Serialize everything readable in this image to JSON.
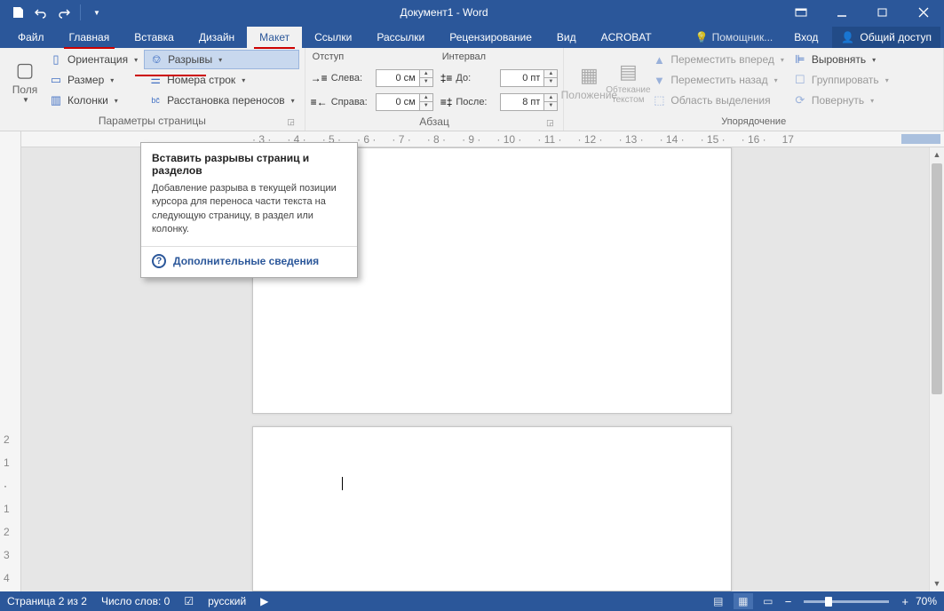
{
  "title": "Документ1 - Word",
  "tabs": {
    "file": "Файл",
    "home": "Главная",
    "insert": "Вставка",
    "design": "Дизайн",
    "layout": "Макет",
    "references": "Ссылки",
    "mailings": "Рассылки",
    "review": "Рецензирование",
    "view": "Вид",
    "acrobat": "ACROBAT"
  },
  "tell_me": "Помощник...",
  "login": "Вход",
  "share": "Общий доступ",
  "ribbon": {
    "margins": "Поля",
    "orientation": "Ориентация",
    "size": "Размер",
    "columns": "Колонки",
    "breaks": "Разрывы",
    "line_numbers": "Номера строк",
    "hyphenation": "Расстановка переносов",
    "page_setup_label": "Параметры страницы",
    "indent_header": "Отступ",
    "indent_left": "Слева:",
    "indent_right": "Справа:",
    "indent_left_val": "0 см",
    "indent_right_val": "0 см",
    "spacing_header": "Интервал",
    "spacing_before": "До:",
    "spacing_after": "После:",
    "spacing_before_val": "0 пт",
    "spacing_after_val": "8 пт",
    "paragraph_label": "Абзац",
    "position": "Положение",
    "wrap_text": "Обтекание текстом",
    "bring_forward": "Переместить вперед",
    "send_backward": "Переместить назад",
    "selection_pane": "Область выделения",
    "align": "Выровнять",
    "group": "Группировать",
    "rotate": "Повернуть",
    "arrange_label": "Упорядочение"
  },
  "tooltip": {
    "title": "Вставить разрывы страниц и разделов",
    "body": "Добавление разрыва в текущей позиции курсора для переноса части текста на следующую страницу, в раздел или колонку.",
    "more": "Дополнительные сведения"
  },
  "ruler_marks": [
    "3",
    "1",
    "4",
    "1",
    "5",
    "1",
    "6",
    "1",
    "7",
    "1",
    "8",
    "1",
    "9",
    "1",
    "10",
    "1",
    "11",
    "1",
    "12",
    "1",
    "13",
    "1",
    "14",
    "1",
    "15",
    "1",
    "16",
    "17"
  ],
  "vruler_marks": [
    "2",
    "1",
    "1",
    "2",
    "3",
    "4"
  ],
  "status": {
    "page": "Страница 2 из 2",
    "words": "Число слов: 0",
    "lang": "русский",
    "zoom": "70%"
  }
}
